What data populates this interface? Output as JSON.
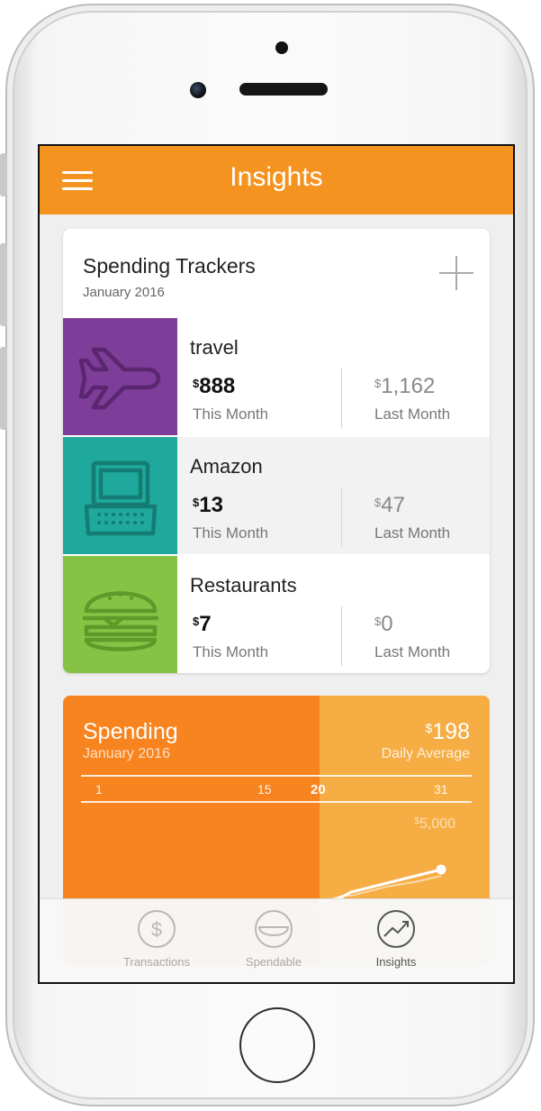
{
  "header": {
    "title": "Insights"
  },
  "trackers": {
    "title": "Spending Trackers",
    "subtitle": "January 2016",
    "this_month_label": "This Month",
    "last_month_label": "Last Month",
    "currency": "$",
    "items": [
      {
        "name": "travel",
        "this_month": "888",
        "last_month": "1,162",
        "color": "#7d3d99",
        "icon": "airplane-icon"
      },
      {
        "name": "Amazon",
        "this_month": "13",
        "last_month": "47",
        "color": "#1fa89c",
        "icon": "laptop-icon"
      },
      {
        "name": "Restaurants",
        "this_month": "7",
        "last_month": "0",
        "color": "#86c244",
        "icon": "burger-icon"
      }
    ]
  },
  "spending": {
    "title": "Spending",
    "subtitle": "January 2016",
    "amount": "198",
    "amount_label": "Daily Average",
    "currency": "$",
    "ticks": [
      "1",
      "15",
      "20",
      "31"
    ],
    "today": "20",
    "y_mark": "5,000",
    "colors": {
      "past": "#f7841f",
      "future": "#f6ad44"
    }
  },
  "tabs": [
    {
      "label": "Transactions",
      "icon": "dollar-circle-icon",
      "active": false
    },
    {
      "label": "Spendable",
      "icon": "spendable-icon",
      "active": false
    },
    {
      "label": "Insights",
      "icon": "trend-chart-icon",
      "active": true
    }
  ],
  "colors": {
    "accent": "#f4931f"
  }
}
